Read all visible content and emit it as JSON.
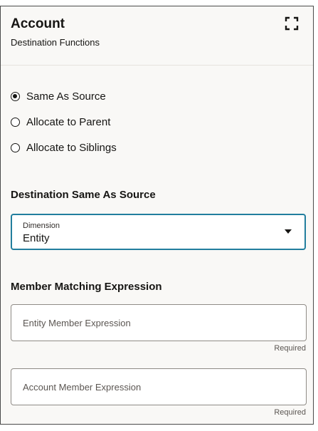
{
  "header": {
    "title": "Account",
    "subtitle": "Destination Functions",
    "expand_icon": "expand-icon"
  },
  "destination_options": [
    {
      "label": "Same As Source",
      "selected": true
    },
    {
      "label": "Allocate to Parent",
      "selected": false
    },
    {
      "label": "Allocate to Siblings",
      "selected": false
    }
  ],
  "same_as_source": {
    "heading": "Destination Same As Source",
    "dimension": {
      "caption": "Dimension",
      "value": "Entity"
    }
  },
  "member_matching": {
    "heading": "Member Matching Expression",
    "fields": [
      {
        "placeholder": "Entity Member Expression",
        "value": "",
        "helper": "Required"
      },
      {
        "placeholder": "Account Member Expression",
        "value": "",
        "helper": "Required"
      }
    ]
  },
  "colors": {
    "focus_border": "#227e9e",
    "panel_bg": "#f9f8f6",
    "text": "#161513"
  }
}
